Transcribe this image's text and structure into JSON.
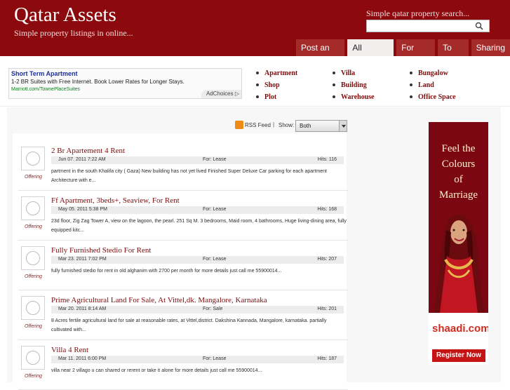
{
  "header": {
    "title": "Qatar Assets",
    "tagline": "Simple property listings in online...",
    "search_label": "Simple qatar property search...",
    "search_value": ""
  },
  "tabs": [
    {
      "label": "Post an Ad.",
      "active": false
    },
    {
      "label": "All Listings",
      "active": true
    },
    {
      "label": "For Sale",
      "active": false
    },
    {
      "label": "To Let",
      "active": false
    },
    {
      "label": "Sharing",
      "active": false
    }
  ],
  "top_ad": {
    "title": "Short Term Apartment",
    "text": "1-2 BR Suites with Free Internet. Book Lower Rates for Longer Stays.",
    "url": "Marriott.com/TownePlaceSuites",
    "choices": "AdChoices ▷"
  },
  "categories": [
    "Apartment",
    "Villa",
    "Bungalow",
    "Shop",
    "Building",
    "Land",
    "Plot",
    "Warehouse",
    "Office Space"
  ],
  "feed": {
    "rss_label": "RSS Feed",
    "separator": "|",
    "show_label": "Show:",
    "show_value": "Both"
  },
  "listings": [
    {
      "title": "2 Br Apartement 4 Rent",
      "date": "Jun 07. 2011 7:22 AM",
      "type": "For: Lease",
      "hits": "Hits: 116",
      "desc": "partment in the south Khalifa city ( Gaza) New building has not yet lived Finished Super Deluxe Car parking for each apartment Architecture with e...",
      "label": "Offering"
    },
    {
      "title": "Ff Apartment, 3beds+, Seaview, For Rent",
      "date": "May 05. 2011 5:38 PM",
      "type": "For: Lease",
      "hits": "Hits: 168",
      "desc": "23d floor, Zig Zag Tower A, view on the lagoon, the pearl. 251 Sq M. 3 bedrooms, Maid room, 4 bathrooms, Huge living-dining area, fully equipped kitc...",
      "label": "Offering"
    },
    {
      "title": "Fully Furnished Stedio For Rent",
      "date": "Mar 23. 2011 7:02 PM",
      "type": "For: Lease",
      "hits": "Hits: 207",
      "desc": "fully furnished stedio for rent in old alghanim with 2700 per month for more details just call me 55900014...",
      "label": "Offering"
    },
    {
      "title": "Prime Agricultural Land For Sale, At Vittel,dk. Mangalore, Karnataka",
      "date": "Mar 20. 2011 8:14 AM",
      "type": "For: Sale",
      "hits": "Hits: 201",
      "desc": "8 Acres fertile agricultural land for sale at reasonable rates, at Vittel,district. Dakshina Kannada, Mangalore, karnataka. partially cultivated with...",
      "label": "Offering"
    },
    {
      "title": "Villa 4 Rent",
      "date": "Mar 11. 2011 6:00 PM",
      "type": "For: Lease",
      "hits": "Hits: 187",
      "desc": "villa near 2 villago u can shared or rerent or take it alone for more details just call me 55900014...",
      "label": "Offering"
    }
  ],
  "side_ad": {
    "headline_1": "Feel the",
    "headline_2": "Colours",
    "headline_3": "of",
    "headline_4": "Marriage",
    "logo": "shaadi.com",
    "button": "Register Now"
  },
  "colors": {
    "header": "#8c0a0d",
    "tab": "#a52a2a",
    "link": "#7c0c0c"
  }
}
